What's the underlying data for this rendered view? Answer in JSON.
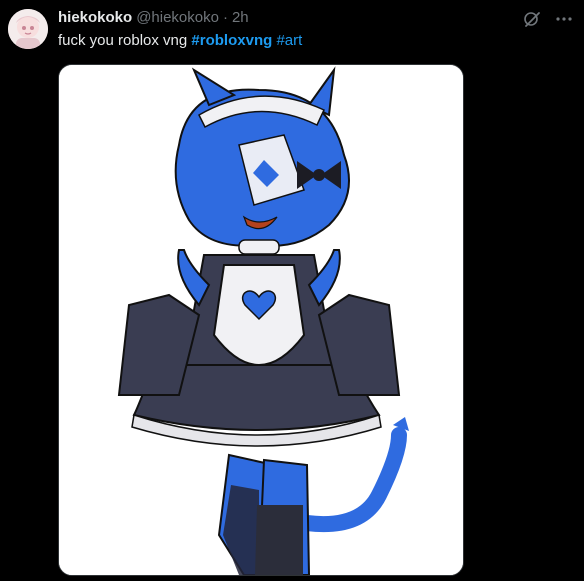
{
  "post": {
    "display_name": "hiekokoko",
    "handle": "@hiekokoko",
    "separator": "·",
    "time": "2h",
    "text": "fuck you roblox vng",
    "hashtags": [
      "#robloxvng",
      "#art"
    ]
  },
  "icons": {
    "grok": "grok-icon",
    "more": "more-icon"
  },
  "colors": {
    "background": "#000000",
    "text": "#e7e9ea",
    "muted": "#71767b",
    "link": "#1d9bf0",
    "character_blue": "#2f6be0"
  }
}
